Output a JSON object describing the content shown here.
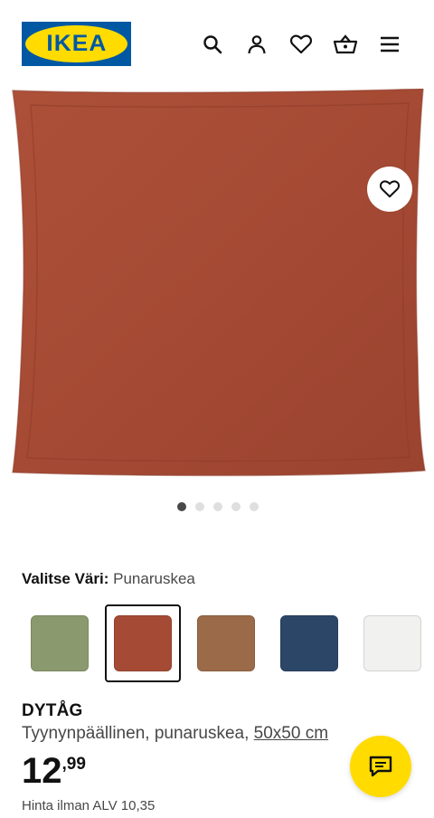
{
  "header": {
    "logo_text": "IKEA",
    "icons": [
      "search-icon",
      "user-icon",
      "heart-icon",
      "cart-icon",
      "menu-icon"
    ]
  },
  "gallery": {
    "current_index": 1,
    "total_images": 5
  },
  "color_selector": {
    "label": "Valitse Väri:",
    "selected_value": "Punaruskea",
    "swatches": [
      {
        "color": "#8a9a6e",
        "selected": false
      },
      {
        "color": "#a54a34",
        "selected": true
      },
      {
        "color": "#9b6a48",
        "selected": false
      },
      {
        "color": "#2c4668",
        "selected": false
      },
      {
        "color": "#f1f1f0",
        "selected": false
      }
    ]
  },
  "product": {
    "name": "DYTÅG",
    "description": "Tyynynpäällinen, punaruskea,",
    "size_link": "50x50 cm",
    "price_integer": "12",
    "price_decimal": ",99",
    "vat_text": "Hinta ilman ALV 10,35"
  },
  "colors": {
    "ikea_blue": "#0058a3",
    "ikea_yellow": "#ffdb00",
    "pillow_main": "#a54a34"
  }
}
